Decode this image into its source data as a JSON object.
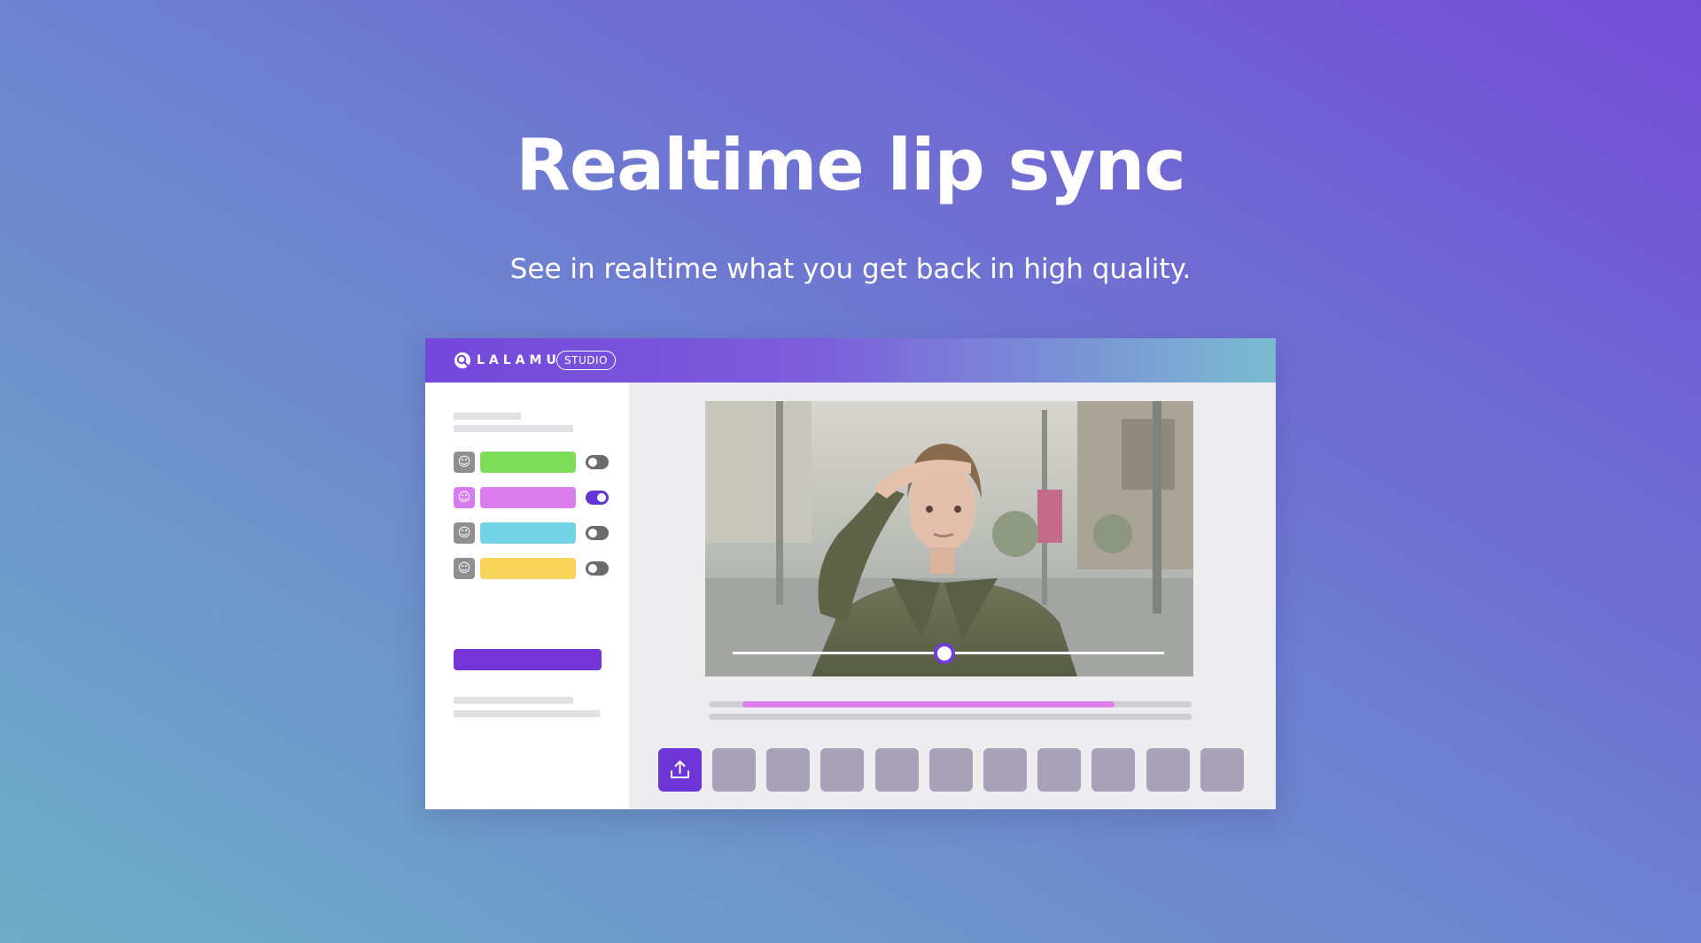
{
  "hero": {
    "title": "Realtime lip sync",
    "subtitle": "See in realtime what you get back in high quality."
  },
  "app": {
    "logo_text": "LALAMU",
    "badge": "STUDIO",
    "logo_icon": "search-icon",
    "tracks": [
      {
        "icon": "smiley-face-icon",
        "color": "#7ddd5b",
        "enabled": false
      },
      {
        "icon": "smiley-face-icon",
        "color": "#da7ded",
        "enabled": true
      },
      {
        "icon": "smiley-face-icon",
        "color": "#72d3e6",
        "enabled": false
      },
      {
        "icon": "smiley-face-icon",
        "color": "#f7d35a",
        "enabled": false
      }
    ],
    "primary_button_color": "#7535d5",
    "video": {
      "playhead_fraction": 0.49
    },
    "timeline": {
      "highlight_color": "#dd7eeb",
      "highlight_start_fraction": 0.07,
      "highlight_end_fraction": 0.84
    },
    "upload_icon": "upload-icon",
    "thumbnail_count": 10
  },
  "colors": {
    "accent": "#6e35d6",
    "gradient_start": "#734dd7",
    "gradient_end": "#6eaec6"
  }
}
